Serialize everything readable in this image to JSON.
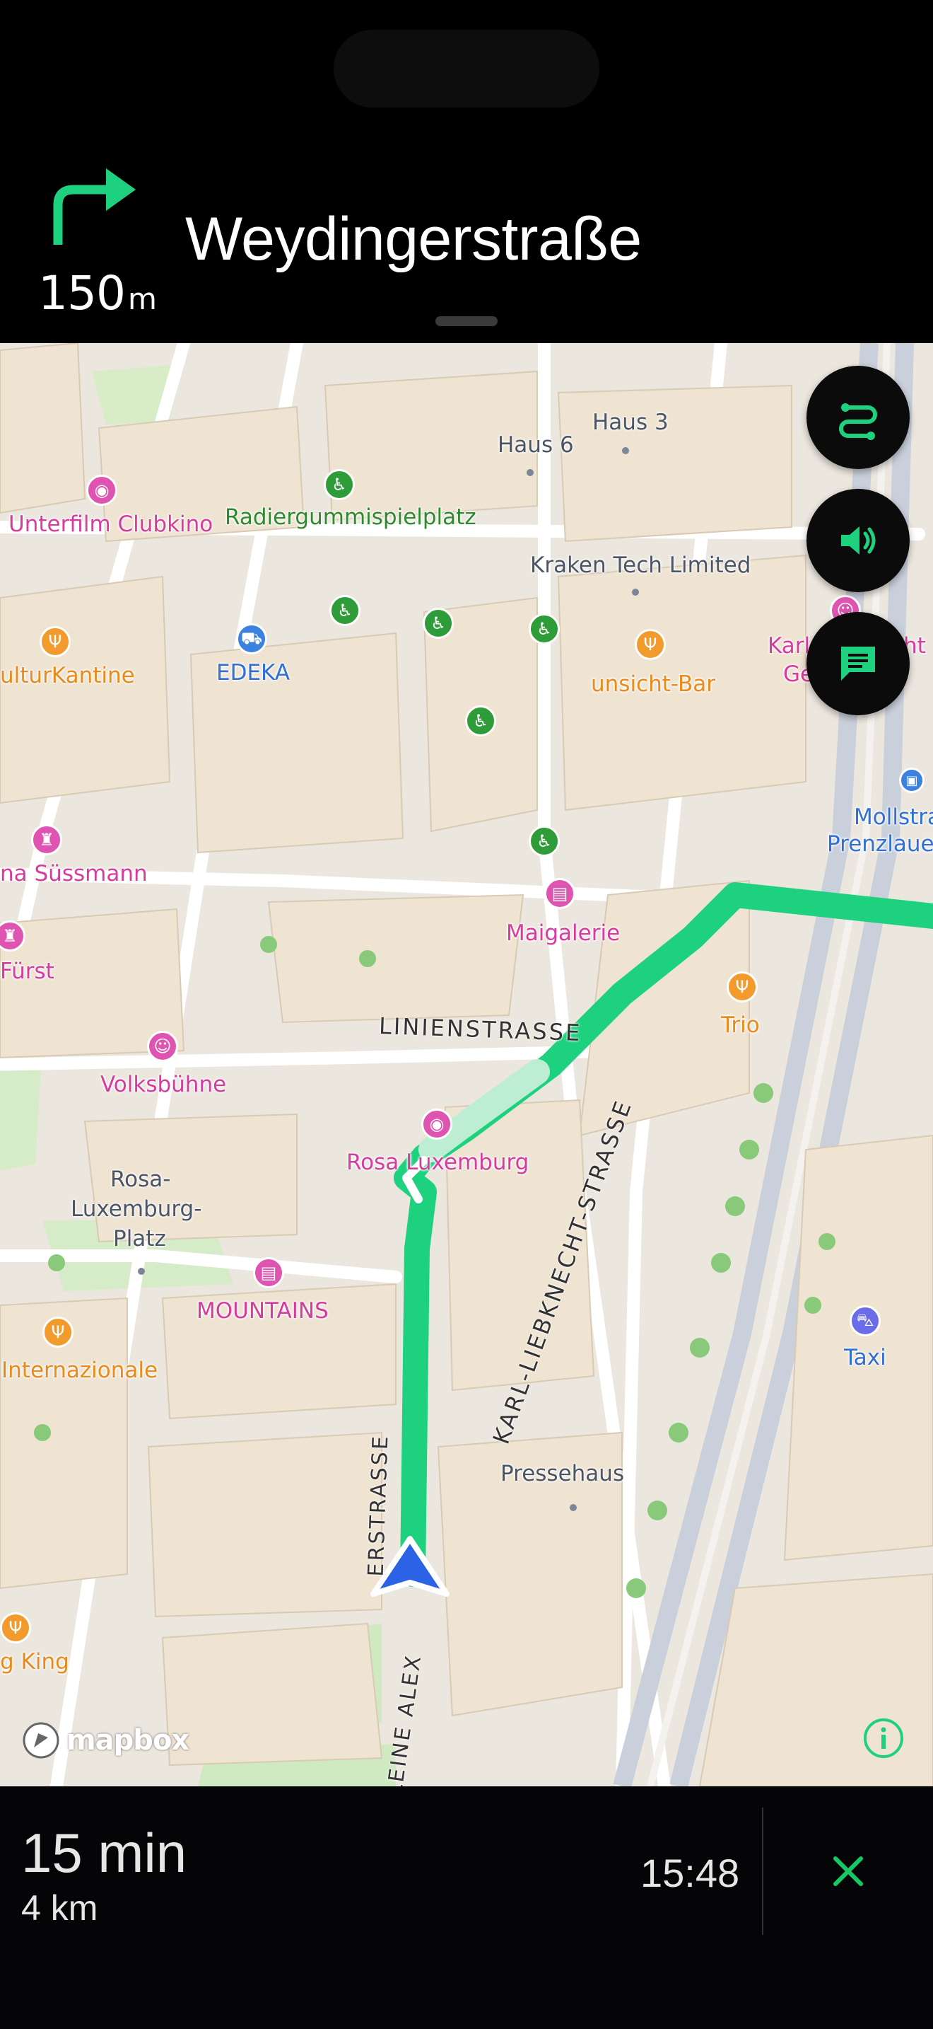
{
  "instruction": {
    "distance_value": "150",
    "distance_unit": "m",
    "street": "Weydingerstraße",
    "maneuver_icon": "turn-right-icon"
  },
  "map": {
    "pois": [
      {
        "id": "unterfilm",
        "label": "Unterfilm Clubkino",
        "color": "pink",
        "icon": "camera-icon"
      },
      {
        "id": "radier",
        "label": "Radiergummispielplatz",
        "color": "green",
        "icon": "playground-icon"
      },
      {
        "id": "haus6",
        "label": "Haus 6",
        "color": "grey"
      },
      {
        "id": "haus3",
        "label": "Haus 3",
        "color": "grey"
      },
      {
        "id": "kraken",
        "label": "Kraken Tech Limited",
        "color": "grey"
      },
      {
        "id": "kulturkantine",
        "label": "ulturKantine",
        "color": "orange",
        "icon": "restaurant-icon"
      },
      {
        "id": "edeka",
        "label": "EDEKA",
        "color": "blue",
        "icon": "cart-icon"
      },
      {
        "id": "unsicht",
        "label": "unsicht-Bar",
        "color": "orange",
        "icon": "restaurant-icon"
      },
      {
        "id": "karl",
        "label": "Karl",
        "color": "pink"
      },
      {
        "id": "ge",
        "label": "Ge",
        "color": "pink"
      },
      {
        "id": "ht",
        "label": "ht",
        "color": "pink"
      },
      {
        "id": "mollstr",
        "label": "Mollstra",
        "color": "blue"
      },
      {
        "id": "prenzlauer",
        "label": "Prenzlaue",
        "color": "blue"
      },
      {
        "id": "sussmann",
        "label": "na Süssmann",
        "color": "pink"
      },
      {
        "id": "maigalerie",
        "label": "Maigalerie",
        "color": "pink",
        "icon": "gallery-icon"
      },
      {
        "id": "furst",
        "label": "Fürst",
        "color": "pink"
      },
      {
        "id": "trio",
        "label": "Trio",
        "color": "orange",
        "icon": "restaurant-icon"
      },
      {
        "id": "volksbuhne",
        "label": "Volksbühne",
        "color": "pink",
        "icon": "theater-icon"
      },
      {
        "id": "rosalux",
        "label": "Rosa Luxemburg",
        "color": "pink",
        "icon": "camera-icon"
      },
      {
        "id": "rosaplatz1",
        "label": "Rosa-",
        "color": "grey"
      },
      {
        "id": "rosaplatz2",
        "label": "Luxemburg-",
        "color": "grey"
      },
      {
        "id": "rosaplatz3",
        "label": "Platz",
        "color": "grey"
      },
      {
        "id": "mountains",
        "label": "MOUNTAINS",
        "color": "pink",
        "icon": "gallery-icon"
      },
      {
        "id": "internazionale",
        "label": "Internazionale",
        "color": "orange",
        "icon": "restaurant-icon"
      },
      {
        "id": "taxi",
        "label": "Taxi",
        "color": "blue",
        "icon": "taxi-icon"
      },
      {
        "id": "pressehaus",
        "label": "Pressehaus",
        "color": "grey"
      },
      {
        "id": "gking",
        "label": "g King",
        "color": "orange",
        "icon": "restaurant-icon"
      }
    ],
    "streets": {
      "linien": "LINIENSTRASSE",
      "karl": "KARL-LIEBKNECHT-STRASSE",
      "alex_top": "ERSTRASSE",
      "alex_bottom": "LEINE ALEX"
    },
    "attribution": "mapbox"
  },
  "trip": {
    "remaining_time": "15 min",
    "remaining_distance": "4 km",
    "arrival_time": "15:48"
  },
  "colors": {
    "route": "#1ed17f",
    "accent": "#17c964",
    "banner": "#000000"
  }
}
